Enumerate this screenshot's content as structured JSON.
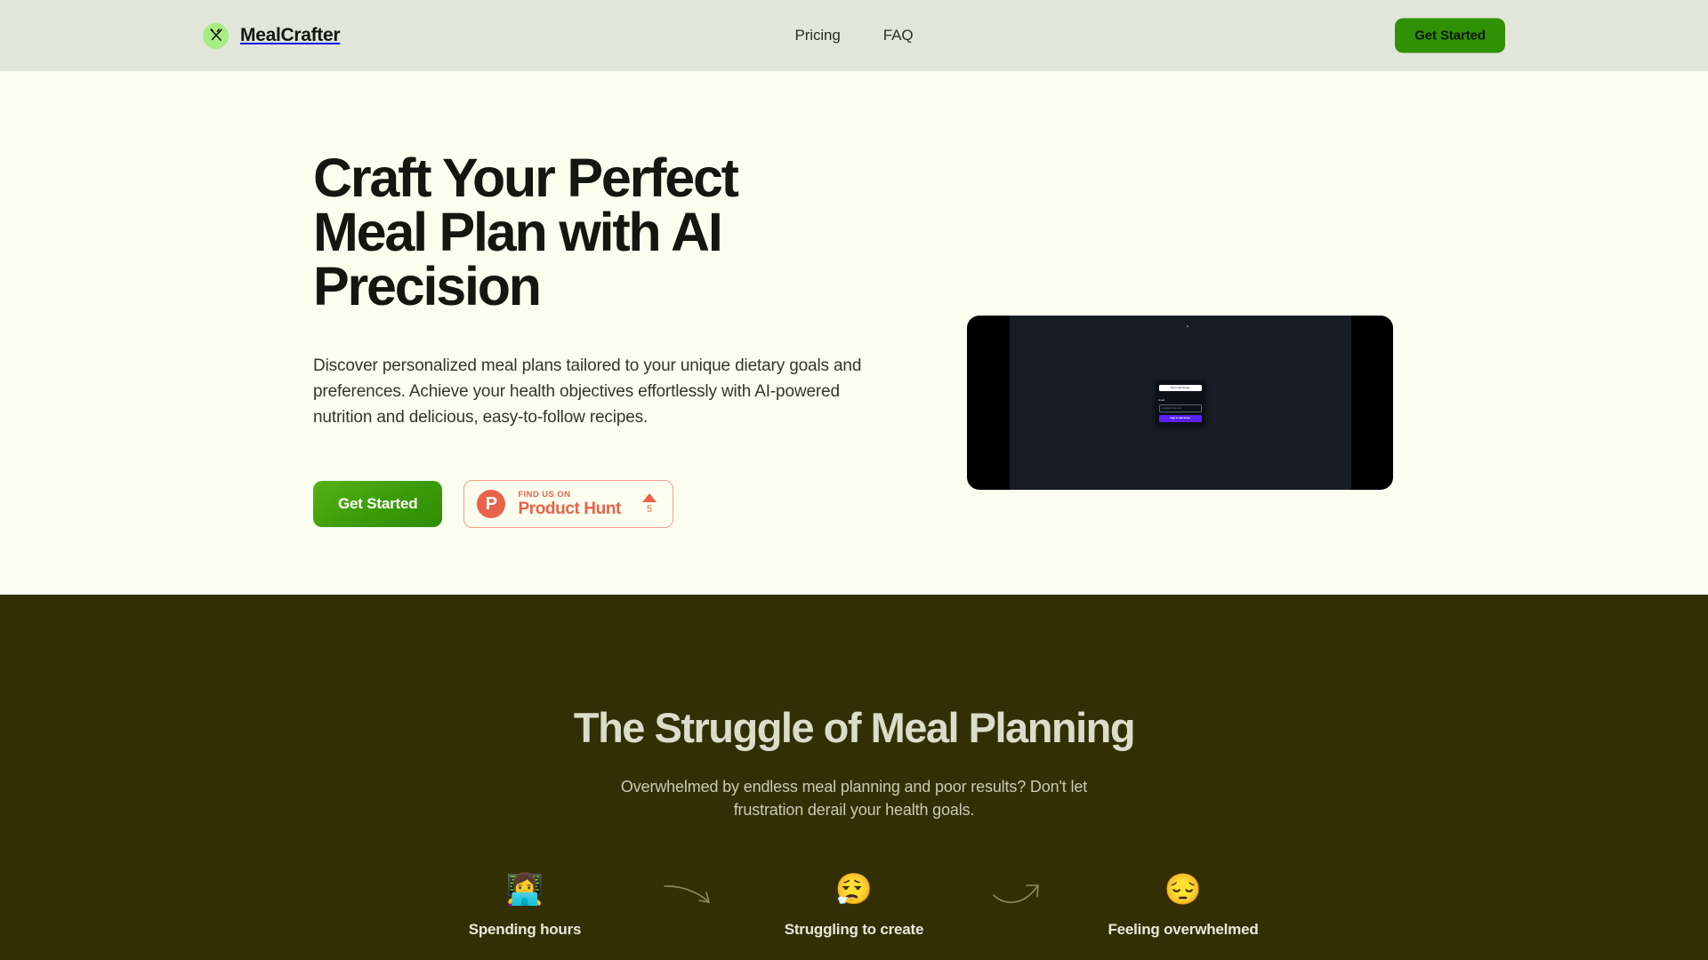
{
  "header": {
    "brand_name": "MealCrafter",
    "brand_icon": "fork-knife-icon",
    "nav": [
      {
        "label": "Pricing"
      },
      {
        "label": "FAQ"
      }
    ],
    "cta_label": "Get Started"
  },
  "hero": {
    "title": "Craft Your Perfect Meal Plan with AI Precision",
    "subtitle": "Discover personalized meal plans tailored to your unique dietary goals and preferences. Achieve your health objectives effortlessly with AI-powered nutrition and delicious, easy-to-follow recipes.",
    "cta_label": "Get Started",
    "product_hunt": {
      "logo_letter": "P",
      "kicker": "FIND US ON",
      "name": "Product Hunt",
      "upvote_icon": "triangle-up-icon",
      "upvote_count": "5"
    },
    "video": {
      "login_card": {
        "google_button": "Sign in with Google",
        "email_label": "Email",
        "email_placeholder": "email@domain.com",
        "submit_button": "Sign in with Email"
      }
    }
  },
  "struggle": {
    "title": "The Struggle of Meal Planning",
    "subtitle": "Overwhelmed by endless meal planning and poor results? Don't let frustration derail your health goals.",
    "steps": [
      {
        "emoji": "👩‍💻",
        "label": "Spending hours"
      },
      {
        "emoji": "😮‍💨",
        "label": "Struggling to create"
      },
      {
        "emoji": "😔",
        "label": "Feeling overwhelmed"
      }
    ],
    "arrow_icons": [
      "curved-arrow-down-right-icon",
      "curved-arrow-up-right-icon"
    ]
  },
  "colors": {
    "header_bg": "#e2e5d9",
    "hero_bg": "#fbfeef",
    "accent_green": "#2f9104",
    "product_hunt": "#ea6249",
    "struggle_bg": "#332f05"
  }
}
